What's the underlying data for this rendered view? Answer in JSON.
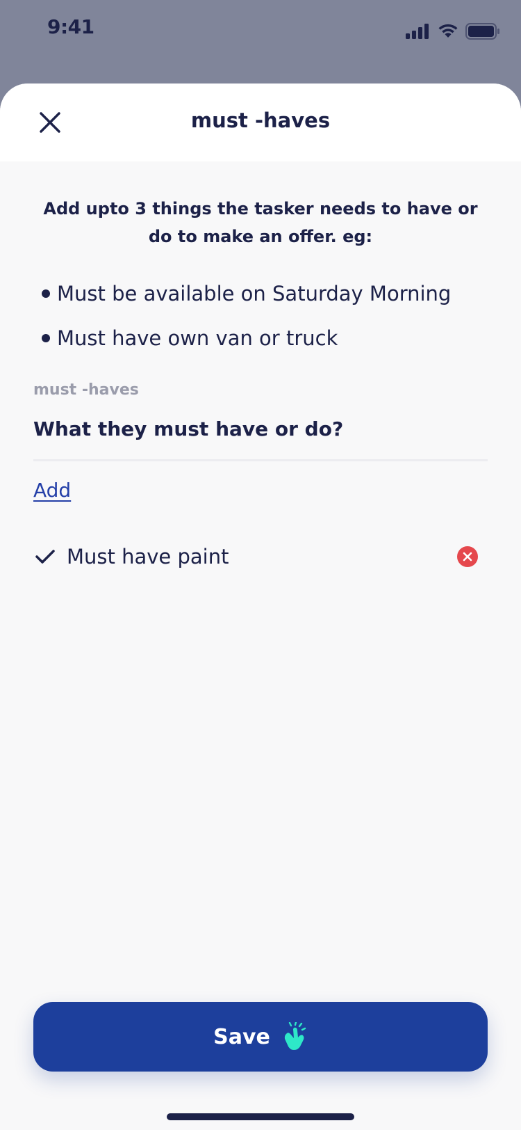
{
  "status_bar": {
    "time": "9:41",
    "icons": [
      "cellular-signal-icon",
      "wifi-icon",
      "battery-icon"
    ]
  },
  "sheet": {
    "title": "must -haves",
    "close_icon": "close-icon"
  },
  "intro": {
    "text": "Add upto 3 things the tasker needs to have or do to make an offer. eg:",
    "examples": [
      "Must be available on Saturday Morning",
      "Must have own van or truck"
    ]
  },
  "field": {
    "label": "must -haves",
    "placeholder": "What they must have or do?",
    "value": ""
  },
  "add_link": "Add",
  "items": [
    {
      "text": "Must have paint",
      "icon": "checkmark-icon",
      "remove_icon": "remove-circle-icon"
    }
  ],
  "save_button": {
    "label": "Save",
    "icon": "snap-hand-icon"
  },
  "colors": {
    "primary": "#1d3f9c",
    "text": "#1c2148",
    "muted": "#9a9cab",
    "remove": "#e5484d",
    "accent": "#2ee8c8",
    "backdrop": "#80859a"
  }
}
